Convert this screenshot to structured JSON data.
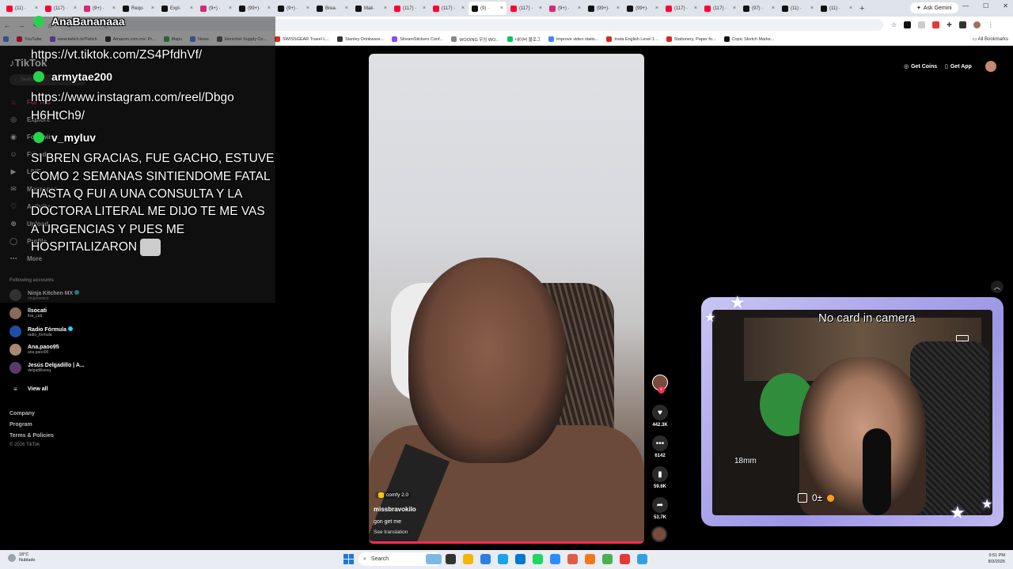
{
  "browser": {
    "tabs": [
      {
        "label": "(11) ·",
        "color": "#ff0033"
      },
      {
        "label": "(117) ·",
        "color": "#ff0033"
      },
      {
        "label": "(9+) ·",
        "color": "#d62976"
      },
      {
        "label": "Reqo·",
        "color": "#111111"
      },
      {
        "label": "Expl·",
        "color": "#111111"
      },
      {
        "label": "(9+) ·",
        "color": "#d62976"
      },
      {
        "label": "(99+)·",
        "color": "#111111"
      },
      {
        "label": "(9+) ·",
        "color": "#111111"
      },
      {
        "label": "Brea·",
        "color": "#111111"
      },
      {
        "label": "Mak·",
        "color": "#111111"
      },
      {
        "label": "(117) ·",
        "color": "#ff0033"
      },
      {
        "label": "(117) ·",
        "color": "#ff0033"
      },
      {
        "label": "(9) ·",
        "color": "#111111",
        "active": true
      },
      {
        "label": "(117) ·",
        "color": "#ff0033"
      },
      {
        "label": "(9+) ·",
        "color": "#d62976"
      },
      {
        "label": "(99+)·",
        "color": "#111111"
      },
      {
        "label": "(99+)·",
        "color": "#111111"
      },
      {
        "label": "(117) ·",
        "color": "#ff0033"
      },
      {
        "label": "(117) ·",
        "color": "#ff0033"
      },
      {
        "label": "(97) ·",
        "color": "#111111"
      },
      {
        "label": "(11) ·",
        "color": "#111111"
      },
      {
        "label": "(11) ·",
        "color": "#111111"
      }
    ],
    "new_tab": "+",
    "ask_gemini": "Ask Gemini",
    "url": "tiktok.com/?_r=1",
    "bookmarks": [
      {
        "label": "YouTube",
        "color": "#ff0033"
      },
      {
        "label": "www.twitch.tv/Twitch",
        "color": "#9146ff"
      },
      {
        "label": "Amazon.com.mx: Pr...",
        "color": "#222222"
      },
      {
        "label": "Maps",
        "color": "#34a853"
      },
      {
        "label": "News",
        "color": "#4285f4"
      },
      {
        "label": "Herschel Supply Co...",
        "color": "#555555"
      },
      {
        "label": "SWISSGEAR Travel L...",
        "color": "#d52b1e"
      },
      {
        "label": "Stanley Drinkware...",
        "color": "#333333"
      },
      {
        "label": "StreamStickers Conf...",
        "color": "#9146ff"
      },
      {
        "label": "WOOING 우잉 WO...",
        "color": "#888888"
      },
      {
        "label": "네이버 블로그",
        "color": "#03c75a"
      },
      {
        "label": "Improve video statis...",
        "color": "#4285f4"
      },
      {
        "label": "Insta English Level 1...",
        "color": "#d52b1e"
      },
      {
        "label": "Stationery, Paper fo...",
        "color": "#d52b1e"
      },
      {
        "label": "Copic Sketch Marke...",
        "color": "#111111"
      }
    ],
    "all_bookmarks": "All Bookmarks"
  },
  "sidebar": {
    "logo": "TikTok",
    "search_placeholder": "Search",
    "nav": [
      {
        "label": "For You",
        "icon": "home-icon",
        "active": true
      },
      {
        "label": "Explore",
        "icon": "compass-icon"
      },
      {
        "label": "Following",
        "icon": "following-icon"
      },
      {
        "label": "Friends",
        "icon": "friends-icon"
      },
      {
        "label": "LIVE",
        "icon": "live-icon"
      },
      {
        "label": "Messages",
        "icon": "messages-icon"
      },
      {
        "label": "Activity",
        "icon": "activity-icon"
      },
      {
        "label": "Upload",
        "icon": "upload-icon"
      },
      {
        "label": "Profile",
        "icon": "profile-icon"
      },
      {
        "label": "More",
        "icon": "more-icon"
      }
    ],
    "following_title": "Following accounts",
    "accounts": [
      {
        "name": "Ninja Kitchen MX",
        "handle": "ninjamexico",
        "verified": true,
        "color": "#444444"
      },
      {
        "name": "llsocati",
        "handle": "llse_cati",
        "verified": false,
        "color": "#8a6a5a"
      },
      {
        "name": "Radio Fórmula",
        "handle": "radio_formula",
        "verified": true,
        "color": "#1d4fa3"
      },
      {
        "name": "Ana.paoo95",
        "handle": "ana.paoo95",
        "verified": false,
        "color": "#a88870"
      },
      {
        "name": "Jesús Delgadillo | A...",
        "handle": "delgadilloesq",
        "verified": false,
        "color": "#5a3a6a"
      }
    ],
    "view_all": "View all",
    "footer": [
      "Company",
      "Program",
      "Terms & Policies"
    ],
    "copyright": "© 2026 TikTok"
  },
  "chat": {
    "messages": [
      {
        "user": "AnaBananaaa",
        "lines": [
          "https://vt.tiktok.com/ZS4PfdhVf/"
        ]
      },
      {
        "user": "armytae200",
        "lines": [
          "https://www.instagram.com/reel/Dbgo",
          "H6HtCh9/"
        ]
      },
      {
        "user": "v_myluv",
        "lines": [
          "SI BREN GRACIAS, FUE GACHO, ESTUVE",
          "COMO 2 SEMANAS SINTIENDOME FATAL",
          "HASTA Q FUI A UNA CONSULTA Y LA",
          "DOCTORA LITERAL ME DIJO TE ME VAS",
          "A URGENCIAS Y PUES ME",
          "HOSPITALIZARON"
        ]
      }
    ]
  },
  "video": {
    "effect": "comfy 2.0",
    "username": "missbravokilo",
    "caption": "gon get me",
    "translation": "See translation",
    "progress": 1.0,
    "likes": "442.3K",
    "comments": "6142",
    "saves": "59.6K",
    "shares": "53.7K"
  },
  "topbar": {
    "get_coins": "Get Coins",
    "get_app": "Get App"
  },
  "webcam": {
    "status_label": "No card in camera",
    "distance": "18mm",
    "shots": "0±"
  },
  "taskbar": {
    "weather_temp": "18°C",
    "weather_desc": "Nublado",
    "search": "Search",
    "time": "9:51 PM",
    "date": "8/3/2026",
    "apps": [
      "#7ab8e6",
      "#333333",
      "#f2b705",
      "#2f7ee6",
      "#1aa3e8",
      "#0078d4",
      "#1ed760",
      "#2d8cff",
      "#e05a4a",
      "#f07a1a",
      "#4caf50",
      "#e53935",
      "#35a0e0"
    ]
  }
}
